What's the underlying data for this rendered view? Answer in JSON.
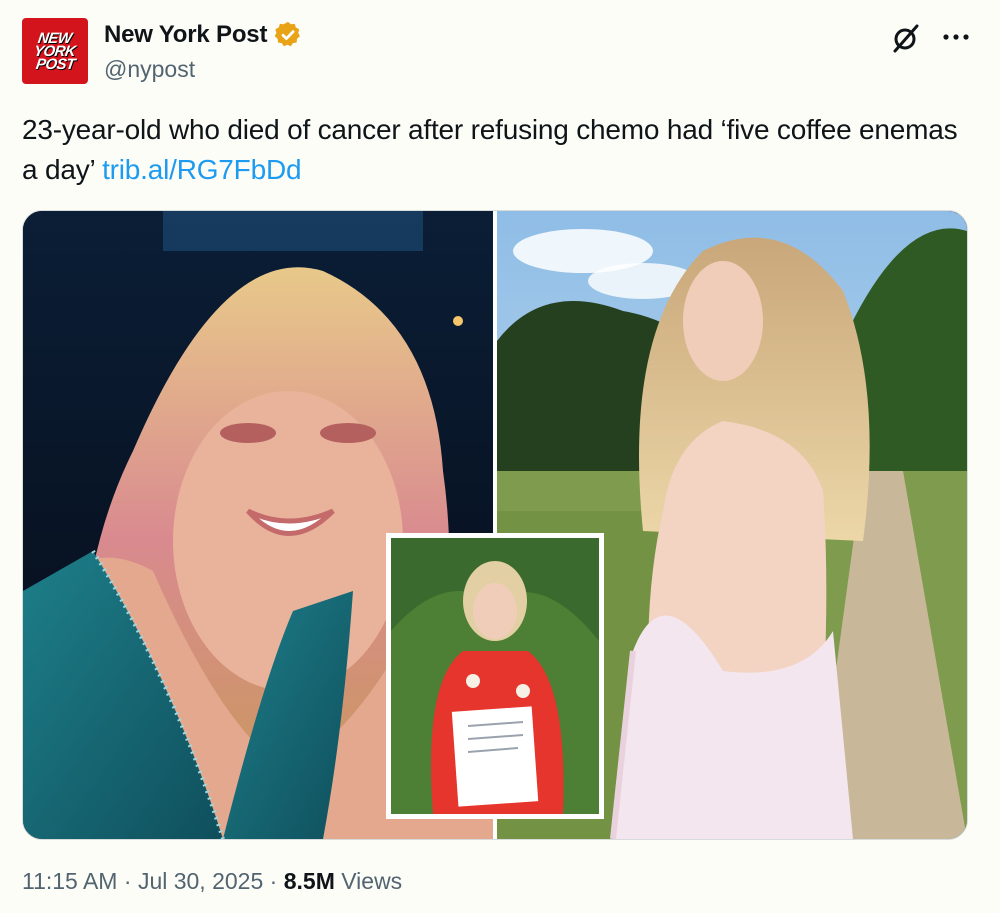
{
  "account": {
    "avatar_lines": [
      "NEW",
      "YORK",
      "POST"
    ],
    "name": "New York Post",
    "handle": "@nypost",
    "verified_badge_icon": "gold-verified-badge-icon"
  },
  "header_actions": {
    "grok_icon": "grok-icon",
    "more_icon": "more-options-icon"
  },
  "tweet": {
    "text": "23-year-old who died of cancer after refusing chemo had ‘five coffee enemas a day’ ",
    "link": "trib.al/RG7FbDd"
  },
  "media": {
    "panels": [
      "left-photo",
      "right-photo",
      "inset-photo"
    ]
  },
  "meta": {
    "time": "11:15 AM",
    "sep1": " · ",
    "date": "Jul 30, 2025",
    "sep2": " · ",
    "views_count": "8.5M",
    "views_label": " Views"
  },
  "colors": {
    "brand_red": "#d3141c",
    "link_blue": "#1d9bf0",
    "verified_gold": "#e8a317",
    "muted_text": "#536471"
  }
}
